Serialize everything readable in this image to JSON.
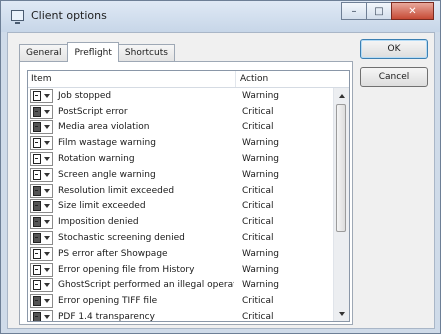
{
  "window": {
    "title": "Client options"
  },
  "caption_buttons": {
    "minimize": "–",
    "maximize": "□",
    "close": "✕"
  },
  "tabs": [
    {
      "label": "General",
      "active": false
    },
    {
      "label": "Preflight",
      "active": true
    },
    {
      "label": "Shortcuts",
      "active": false
    }
  ],
  "list": {
    "columns": {
      "item": "Item",
      "action": "Action"
    },
    "rows": [
      {
        "icon": "document-icon",
        "item": "Job stopped",
        "action": "Warning"
      },
      {
        "icon": "document-filled-icon",
        "item": "PostScript error",
        "action": "Critical"
      },
      {
        "icon": "document-filled-icon",
        "item": "Media area violation",
        "action": "Critical"
      },
      {
        "icon": "document-icon",
        "item": "Film wastage warning",
        "action": "Warning"
      },
      {
        "icon": "document-icon",
        "item": "Rotation warning",
        "action": "Warning"
      },
      {
        "icon": "document-icon",
        "item": "Screen angle warning",
        "action": "Warning"
      },
      {
        "icon": "document-filled-icon",
        "item": "Resolution limit exceeded",
        "action": "Critical"
      },
      {
        "icon": "document-filled-icon",
        "item": "Size limit exceeded",
        "action": "Critical"
      },
      {
        "icon": "document-filled-icon",
        "item": "Imposition denied",
        "action": "Critical"
      },
      {
        "icon": "document-filled-icon",
        "item": "Stochastic screening denied",
        "action": "Critical"
      },
      {
        "icon": "document-icon",
        "item": "PS error after Showpage",
        "action": "Warning"
      },
      {
        "icon": "document-icon",
        "item": "Error opening file from History",
        "action": "Warning"
      },
      {
        "icon": "document-icon",
        "item": "GhostScript performed an illegal operation",
        "action": "Warning"
      },
      {
        "icon": "document-filled-icon",
        "item": "Error opening TIFF file",
        "action": "Critical"
      },
      {
        "icon": "document-filled-icon",
        "item": "PDF 1.4 transparency",
        "action": "Critical"
      }
    ]
  },
  "buttons": {
    "ok": "OK",
    "cancel": "Cancel"
  }
}
